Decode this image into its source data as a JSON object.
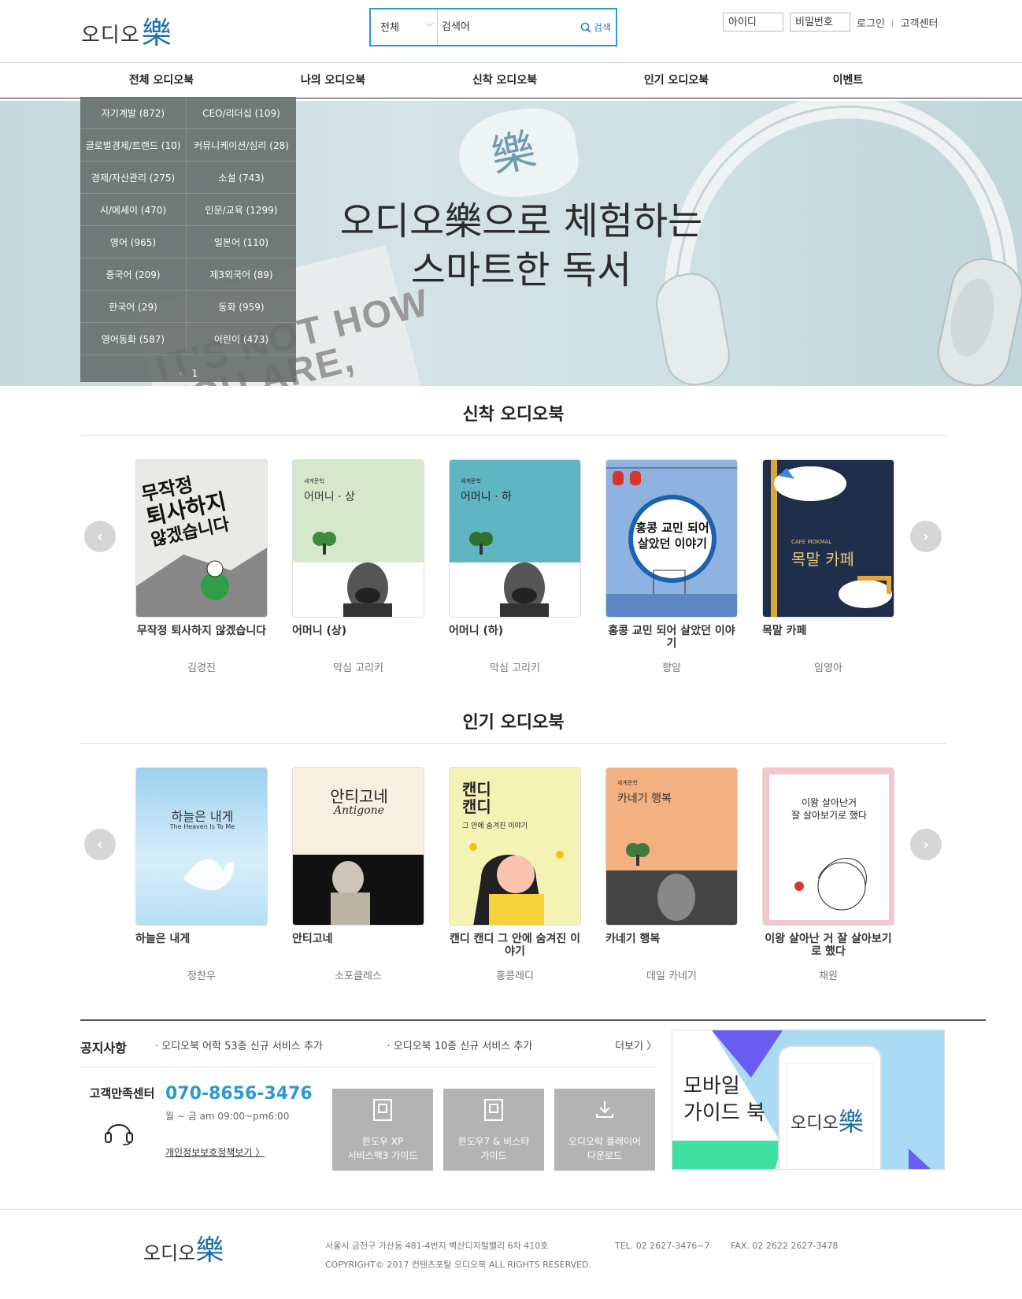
{
  "header": {
    "logo_text": "오디오",
    "logo_han": "樂",
    "search": {
      "category": "전체",
      "placeholder": "검색어",
      "button": "검색"
    },
    "login": {
      "id_placeholder": "아이디",
      "pw_placeholder": "비밀번호",
      "login_label": "로그인",
      "separator": "|",
      "support_label": "고객센터"
    }
  },
  "nav": [
    "전체 오디오북",
    "나의 오디오북",
    "신착 오디오북",
    "인기 오디오북",
    "이벤트"
  ],
  "hero": {
    "headline_line1": "오디오樂으로 체험하는",
    "headline_line2": "스마트한 독서",
    "bubble_han": "樂",
    "book_text_line1": "IT'S NOT HOW",
    "book_text_line2": "YOU ARE,"
  },
  "categories": [
    "자기계발 (872)",
    "CEO/리더십 (109)",
    "글로벌경제/트랜드 (10)",
    "커뮤니케이션/심리 (28)",
    "경제/자산관리 (275)",
    "소설 (743)",
    "시/에세이 (470)",
    "인문/교육 (1299)",
    "영어 (965)",
    "일본어 (110)",
    "중국어 (209)",
    "제3외국어 (89)",
    "한국어 (29)",
    "동화 (959)",
    "영어동화 (587)",
    "어린이 (473)"
  ],
  "category_pages": [
    "1"
  ],
  "new_section": {
    "title": "신착 오디오북",
    "books": [
      {
        "title": "무작정 퇴사하지 않겠습니다",
        "author": "김경진"
      },
      {
        "title": "어머니 (상)",
        "author": "막심 고리키"
      },
      {
        "title": "어머니 (하)",
        "author": "막심 고리키"
      },
      {
        "title": "홍콩 교민 되어 살았던 이야기",
        "author": "향암"
      },
      {
        "title": "목말 카페",
        "author": "임영아"
      }
    ]
  },
  "popular_section": {
    "title": "인기 오디오북",
    "books": [
      {
        "title": "하늘은 내게",
        "author": "정찬우"
      },
      {
        "title": "안티고네",
        "author": "소포클레스"
      },
      {
        "title": "캔디 캔디 그 안에 숨겨진 이야기",
        "author": "홍콩레디"
      },
      {
        "title": "카네기 행복",
        "author": "데일 카네기"
      },
      {
        "title": "이왕 살아난 거 잘 살아보기로 했다",
        "author": "채원"
      }
    ]
  },
  "covers": {
    "c1": {
      "line1": "무작정",
      "line2": "퇴사하지",
      "line3": "않겠습니다"
    },
    "c2": {
      "series": "세계문학",
      "title": "어머니 · 상"
    },
    "c3": {
      "series": "세계문학",
      "title": "어머니 · 하"
    },
    "c4": {
      "line1": "홍콩 교민 되어",
      "line2": "살았던 이야기"
    },
    "c5": {
      "en": "CAFE MOKMAL",
      "title": "목말 카페"
    },
    "p1": {
      "title": "하늘은 내게",
      "en": "The Heaven Is To Me"
    },
    "p2": {
      "title": "안티고네",
      "en": "Antigone"
    },
    "p3": {
      "line1": "캔디",
      "line2": "캔디",
      "sub": "그 안에 숨겨진 이야기"
    },
    "p4": {
      "series": "세계문학",
      "title": "카네기 행복"
    },
    "p5": {
      "line1": "이왕 살아난거",
      "line2": "잘 살아보기로 했다"
    }
  },
  "notice": {
    "label": "공지사항",
    "items": [
      "· 오디오북 어학 53종 신규 서비스 추가",
      "· 오디오북 10종 신규 서비스 추가"
    ],
    "more": "더보기 〉"
  },
  "customer": {
    "label": "고객만족센터",
    "tel": "070-8656-3476",
    "hours": "월 ~ 금 am 09:00~pm6:00",
    "privacy": "개인정보보호정책보기 〉"
  },
  "guides": [
    {
      "line1": "윈도우 XP",
      "line2": "서비스팩3 가이드"
    },
    {
      "line1": "윈도우7 & 비스타",
      "line2": "가이드"
    },
    {
      "line1": "오디오락 플레이어",
      "line2": "다운로드"
    }
  ],
  "mobile_guide": {
    "line1": "모바일",
    "line2": "가이드 북",
    "logo_text": "오디오",
    "logo_han": "樂"
  },
  "footer": {
    "logo_text": "오디오",
    "logo_han": "樂",
    "address": "서울시 금천구 가산동 481-4번지 벽산디지털밸리 6차 410호",
    "tel": "TEL. 02 2627-3476~7",
    "fax": "FAX. 02 2622 2627-3478",
    "copyright": "COPYRIGHT© 2017 컨텐츠포탈 오디오북 ALL RIGHTS RESERVED."
  },
  "colors": {
    "accent": "#2f97d6",
    "logo_blue": "#1c6fa8",
    "category_panel": "#68706e"
  }
}
